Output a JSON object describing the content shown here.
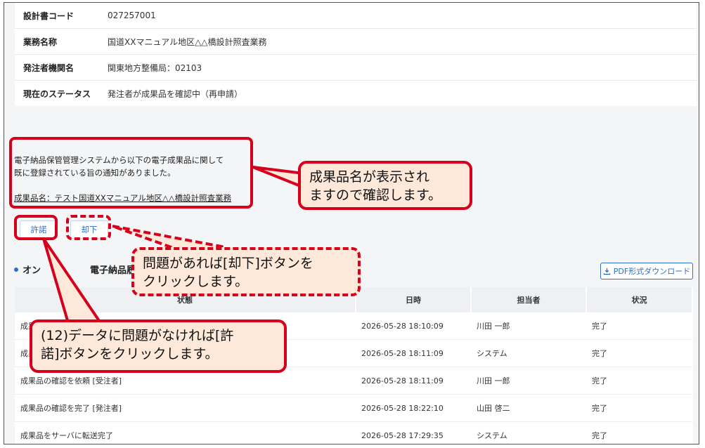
{
  "info": {
    "rows": [
      {
        "label": "設計書コード",
        "value": "027257001"
      },
      {
        "label": "業務名称",
        "value": "国道XXマニュアル地区△△橋設計照査業務"
      },
      {
        "label": "発注者機関名",
        "value": "関東地方整備局：02103"
      },
      {
        "label": "現在のステータス",
        "value": "発注者が成果品を確認中（再申請）"
      }
    ]
  },
  "message": {
    "line1": "電子納品保管管理システムから以下の電子成果品に関して",
    "line2": "既に登録されている旨の通知がありました。",
    "product": "成果品名：テスト国道XXマニュアル地区△△橋設計照査業務"
  },
  "buttons": {
    "approve": "許諾",
    "reject": "却下"
  },
  "section": {
    "title": "オン",
    "title_tail": "電子納品履",
    "pdf": "PDF形式ダウンロード"
  },
  "table": {
    "headers": [
      "状態",
      "日時",
      "担当者",
      "状況"
    ],
    "rows": [
      {
        "status": "成果",
        "datetime": "2026-05-28 18:10:09",
        "person": "川田 一郎",
        "state": "完了"
      },
      {
        "status": "成果",
        "datetime": "2026-05-28 18:11:09",
        "person": "システム",
        "state": "完了"
      },
      {
        "status": "成果品の確認を依頼 [受注者]",
        "datetime": "2026-05-28 18:11:09",
        "person": "川田 一郎",
        "state": "完了"
      },
      {
        "status": "成果品の確認を完了 [発注者]",
        "datetime": "2026-05-28 18:22:10",
        "person": "山田 啓二",
        "state": "完了"
      },
      {
        "status": "成果品をサーバに転送完了",
        "datetime": "2026-05-28 17:29:35",
        "person": "システム",
        "state": "完了"
      }
    ]
  },
  "callouts": {
    "product": {
      "line1": "成果品名が表示され",
      "line2": "ますので確認します。"
    },
    "reject": {
      "line1": "問題があれば[却下]ボタンを",
      "line2": "クリックします。"
    },
    "approve": {
      "line1": "(12)データに問題がなければ[許",
      "line2": "諾]ボタンをクリックします。"
    }
  },
  "colors": {
    "accent": "#2a6ecf",
    "callout_border": "#d6001c",
    "callout_fill": "#fde8d9"
  },
  "icons": {
    "pdf": "download-icon"
  }
}
